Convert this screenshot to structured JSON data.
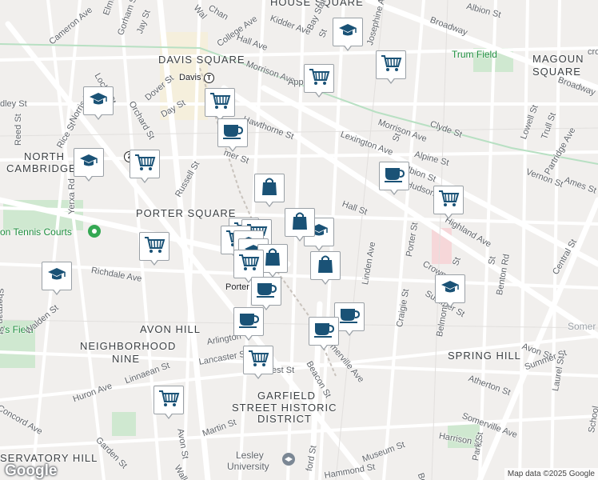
{
  "map": {
    "neighborhoods": [
      {
        "id": "davis-square",
        "text": "DAVIS SQUARE"
      },
      {
        "id": "magoun-square-1",
        "text": "MAGOUN"
      },
      {
        "id": "magoun-square-2",
        "text": "SQUARE"
      },
      {
        "id": "north-cambridge-1",
        "text": "NORTH"
      },
      {
        "id": "north-cambridge-2",
        "text": "CAMBRIDGE"
      },
      {
        "id": "porter-square",
        "text": "PORTER SQUARE"
      },
      {
        "id": "avon-hill",
        "text": "AVON HILL"
      },
      {
        "id": "neighborhood-nine-1",
        "text": "NEIGHBORHOOD"
      },
      {
        "id": "neighborhood-nine-2",
        "text": "NINE"
      },
      {
        "id": "spring-hill",
        "text": "SPRING HILL"
      },
      {
        "id": "garfield-1",
        "text": "GARFIELD"
      },
      {
        "id": "garfield-2",
        "text": "STREET HISTORIC"
      },
      {
        "id": "garfield-3",
        "text": "DISTRICT"
      },
      {
        "id": "observatory-hill",
        "text": "SERVATORY HILL"
      },
      {
        "id": "house-square",
        "text": "HOUSE SQUARE"
      }
    ],
    "places": [
      {
        "id": "davis-station",
        "text": "Davis"
      },
      {
        "id": "porter-station",
        "text": "Porter"
      },
      {
        "id": "trum-field",
        "text": "Trum Field"
      },
      {
        "id": "tennis-courts",
        "text": "on Tennis Courts"
      },
      {
        "id": "rs-field",
        "text": "r's Field"
      },
      {
        "id": "lesley-1",
        "text": "Lesley"
      },
      {
        "id": "lesley-2",
        "text": "University"
      },
      {
        "id": "somerv",
        "text": "Somer"
      }
    ],
    "streets": [
      {
        "id": "s1",
        "text": "Cameron Ave"
      },
      {
        "id": "s2",
        "text": "Elmwood"
      },
      {
        "id": "s3",
        "text": "Gorham St"
      },
      {
        "id": "s4",
        "text": "Jay St"
      },
      {
        "id": "s5",
        "text": "College Ave"
      },
      {
        "id": "s6",
        "text": "Kidder Ave"
      },
      {
        "id": "s7",
        "text": "Hall Ave"
      },
      {
        "id": "s8",
        "text": "Bay State Ave"
      },
      {
        "id": "s9",
        "text": "Josephine Ave"
      },
      {
        "id": "s10",
        "text": "Broadway"
      },
      {
        "id": "s11",
        "text": "Albion St"
      },
      {
        "id": "s12",
        "text": "Broadway"
      },
      {
        "id": "s13",
        "text": "Morrison Ave"
      },
      {
        "id": "s14",
        "text": "Morrison Ave"
      },
      {
        "id": "s15",
        "text": "Clyde St"
      },
      {
        "id": "s16",
        "text": "Lexington Ave"
      },
      {
        "id": "s17",
        "text": "Alpine St"
      },
      {
        "id": "s18",
        "text": "Albion St"
      },
      {
        "id": "s19",
        "text": "Hudson St"
      },
      {
        "id": "s20",
        "text": "Lowell St"
      },
      {
        "id": "s21",
        "text": "Trull St"
      },
      {
        "id": "s22",
        "text": "Partridge Ave"
      },
      {
        "id": "s23",
        "text": "Vernon St"
      },
      {
        "id": "s24",
        "text": "Ames St"
      },
      {
        "id": "s25",
        "text": "Dover St"
      },
      {
        "id": "s26",
        "text": "Orchard St"
      },
      {
        "id": "s27",
        "text": "Day St"
      },
      {
        "id": "s28",
        "text": "Locke St"
      },
      {
        "id": "s29",
        "text": "Norris St"
      },
      {
        "id": "s30",
        "text": "Rice St"
      },
      {
        "id": "s31",
        "text": "Reed St"
      },
      {
        "id": "s32",
        "text": "dley St"
      },
      {
        "id": "s33",
        "text": "Hawthorne St"
      },
      {
        "id": "s34",
        "text": "mer St"
      },
      {
        "id": "s35",
        "text": "Russell St"
      },
      {
        "id": "s36",
        "text": "Yerxa Rd"
      },
      {
        "id": "s37",
        "text": "Hall St"
      },
      {
        "id": "s38",
        "text": "Highland Ave"
      },
      {
        "id": "s39",
        "text": "Central St"
      },
      {
        "id": "s40",
        "text": "Porter St"
      },
      {
        "id": "s41",
        "text": "Crown St"
      },
      {
        "id": "s42",
        "text": "Linden Ave"
      },
      {
        "id": "s43",
        "text": "Benton Rd"
      },
      {
        "id": "s44",
        "text": "Summer St"
      },
      {
        "id": "s45",
        "text": "Craigie St"
      },
      {
        "id": "s46",
        "text": "Belmont St"
      },
      {
        "id": "s47",
        "text": "Avon St"
      },
      {
        "id": "s48",
        "text": "Summer St"
      },
      {
        "id": "s49",
        "text": "Sherman St"
      },
      {
        "id": "s50",
        "text": "Richdale Ave"
      },
      {
        "id": "s51",
        "text": "Walden St"
      },
      {
        "id": "s52",
        "text": "Arlington"
      },
      {
        "id": "s53",
        "text": "Lancaster St"
      },
      {
        "id": "s54",
        "text": "est St"
      },
      {
        "id": "s55",
        "text": "Somerville Ave"
      },
      {
        "id": "s56",
        "text": "Beacon St"
      },
      {
        "id": "s57",
        "text": "Atherton St"
      },
      {
        "id": "s58",
        "text": "Laurel St"
      },
      {
        "id": "s59",
        "text": "Somerville Ave"
      },
      {
        "id": "s60",
        "text": "Huron Ave"
      },
      {
        "id": "s61",
        "text": "Linnaean St"
      },
      {
        "id": "s62",
        "text": "Martin St"
      },
      {
        "id": "s63",
        "text": "Avon St"
      },
      {
        "id": "s64",
        "text": "Concord Ave"
      },
      {
        "id": "s65",
        "text": "Garden St"
      },
      {
        "id": "s66",
        "text": "Walker"
      },
      {
        "id": "s67",
        "text": "Harrison St"
      },
      {
        "id": "s68",
        "text": "Museum St"
      },
      {
        "id": "s69",
        "text": "Hammond St"
      },
      {
        "id": "s70",
        "text": "Park St"
      },
      {
        "id": "s71",
        "text": "School"
      },
      {
        "id": "s72",
        "text": "Chan"
      },
      {
        "id": "s73",
        "text": "Wal"
      },
      {
        "id": "s74",
        "text": "Appl"
      },
      {
        "id": "s75",
        "text": "Hi"
      },
      {
        "id": "s76",
        "text": "St"
      },
      {
        "id": "s77",
        "text": "St"
      },
      {
        "id": "s78",
        "text": "St"
      },
      {
        "id": "s79",
        "text": "Bea"
      },
      {
        "id": "s80",
        "text": "ford St"
      },
      {
        "id": "s81",
        "text": "St"
      },
      {
        "id": "s82",
        "text": "cross"
      }
    ],
    "route_shields": [
      {
        "id": "r2",
        "text": "2"
      }
    ],
    "markers": [
      {
        "id": "m1",
        "type": "school"
      },
      {
        "id": "m2",
        "type": "grocery"
      },
      {
        "id": "m3",
        "type": "grocery"
      },
      {
        "id": "m4",
        "type": "grocery"
      },
      {
        "id": "m5",
        "type": "school"
      },
      {
        "id": "m6",
        "type": "cafe"
      },
      {
        "id": "m7",
        "type": "school"
      },
      {
        "id": "m8",
        "type": "grocery"
      },
      {
        "id": "m9",
        "type": "shopping"
      },
      {
        "id": "m10",
        "type": "cafe"
      },
      {
        "id": "m11",
        "type": "grocery"
      },
      {
        "id": "m12",
        "type": "grocery"
      },
      {
        "id": "m13",
        "type": "grocery"
      },
      {
        "id": "m14",
        "type": "school"
      },
      {
        "id": "m15",
        "type": "shopping"
      },
      {
        "id": "m16",
        "type": "grocery"
      },
      {
        "id": "m17",
        "type": "school"
      },
      {
        "id": "m18",
        "type": "school"
      },
      {
        "id": "m19",
        "type": "shopping"
      },
      {
        "id": "m20",
        "type": "grocery"
      },
      {
        "id": "m21",
        "type": "grocery"
      },
      {
        "id": "m22",
        "type": "shopping"
      },
      {
        "id": "m23",
        "type": "cafe"
      },
      {
        "id": "m24",
        "type": "cafe"
      },
      {
        "id": "m25",
        "type": "cafe"
      },
      {
        "id": "m26",
        "type": "cafe"
      },
      {
        "id": "m27",
        "type": "grocery"
      },
      {
        "id": "m28",
        "type": "school"
      },
      {
        "id": "m29",
        "type": "school"
      },
      {
        "id": "m30",
        "type": "grocery"
      }
    ],
    "logo": "Google",
    "attribution": "Map data ©2025 Google"
  }
}
